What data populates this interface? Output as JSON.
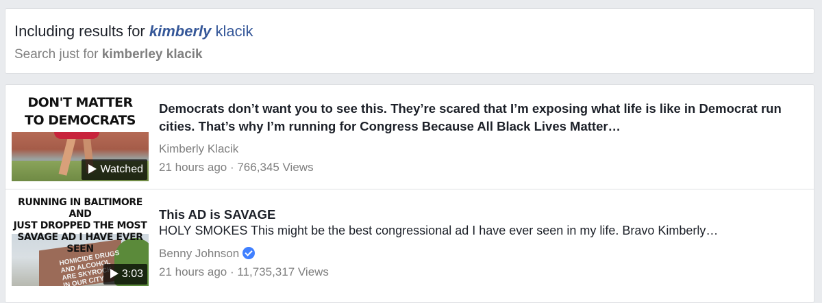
{
  "spelling": {
    "prefix": "Including results for ",
    "corrected_bold": "kimberly",
    "corrected_rest": " klacik",
    "search_prefix": "Search just for ",
    "original_query": "kimberley klacik"
  },
  "results": [
    {
      "thumbnail_text": "DON'T MATTER\nTO DEMOCRATS",
      "badge": "Watched",
      "title": "Democrats don’t want you to see this. They’re scared that I’m exposing what life is like in Democrat run cities. That’s why I’m running for Congress Because All Black Lives Matter…",
      "author": "Kimberly Klacik",
      "verified": false,
      "meta": "21 hours ago · 766,345 Views"
    },
    {
      "thumbnail_text": "RUNNING IN BALTIMORE AND\nJUST DROPPED THE MOST\nSAVAGE AD I HAVE EVER SEEN",
      "thumbnail_graffiti": "HOMICIDE DRUGS\nAND ALCOHOL\nARE SKYROCK\nIN OUR CITY",
      "badge": "3:03",
      "title": "This AD is SAVAGE",
      "snippet": "HOLY SMOKES This might be the best congressional ad I have ever seen in my life. Bravo Kimberly…",
      "author": "Benny Johnson",
      "verified": true,
      "meta": "21 hours ago · 11,735,317 Views"
    }
  ],
  "colors": {
    "background": "#e9ebee",
    "link": "#365899",
    "text": "#1d2129",
    "muted": "#7f7f7f",
    "verified": "#4080ff"
  }
}
